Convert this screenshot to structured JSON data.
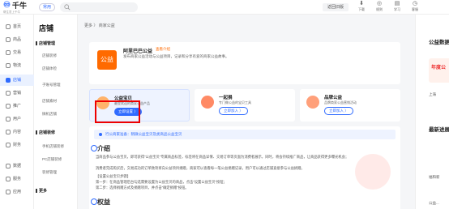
{
  "top": {
    "logo_mark": "♾",
    "logo_name": "千牛",
    "logo_sub": "帮生意上千牛",
    "env": "常用",
    "back_label": "返回旧版",
    "icons": [
      {
        "glyph": "⬇",
        "label": "下载",
        "icon": "download-icon"
      },
      {
        "glyph": "◎",
        "label": "规则",
        "icon": "rules-icon"
      },
      {
        "glyph": "▤",
        "label": "学习",
        "icon": "study-icon"
      },
      {
        "glyph": "◷",
        "label": "客服",
        "icon": "service-icon"
      }
    ]
  },
  "leftnav": [
    {
      "label": "首页"
    },
    {
      "label": "商品"
    },
    {
      "label": "交易"
    },
    {
      "label": "物流"
    },
    {
      "label": "店铺",
      "active": true
    },
    {
      "label": "营销"
    },
    {
      "label": "推广"
    },
    {
      "label": "用户"
    },
    {
      "label": "内容"
    },
    {
      "label": "财务"
    },
    {
      "label": "数据"
    },
    {
      "label": "服务"
    },
    {
      "label": "应用"
    }
  ],
  "subnav": {
    "title": "店铺",
    "groups": [
      {
        "head": "店铺管理",
        "items": [
          "店铺装修",
          "店铺体检",
          "子账号管理",
          "店铺素材",
          "微机店铺"
        ]
      },
      {
        "head": "店铺装修",
        "items": [
          "手机店铺装修",
          "PC店铺装修",
          "装修管理"
        ]
      }
    ],
    "more": "更多"
  },
  "main": {
    "breadcrumb": "更多 〉 商家公益",
    "intro": {
      "logo_text": "公益",
      "title": "阿里巴巴公益",
      "tag": "查看介绍",
      "desc": "发布商家公益活动与公益项目，记录和分享有爱的商家公益故事。"
    },
    "services": [
      {
        "title": "公益宝贝",
        "desc": "最受欢迎的商家公益产品",
        "button": "立即设置 〉"
      },
      {
        "title": "一起捐",
        "desc": "专门做公益的宝贝工具",
        "button": "立即加入 〉"
      },
      {
        "title": "品牌公益",
        "desc": "品牌商家公益营销活动",
        "button": "立即加入 〉"
      }
    ],
    "notice": "行公商家准备：稍微公益宝贝及类商品公益宝贝",
    "section1_title": "介绍",
    "paragraphs": [
      "当商品参与公益宝贝，即可获得“公益宝贝”专属商品标签，标签将在商品详情、交易订单等页面为消费者展示，同时，将会持续推广商品，让商品获得更多曝光机会；",
      "消费者完成购买后，交易成功的订单款项将向公益项目捐赠，商家可以查看每一笔公益捐赠记录，用户可以通过店铺直接参与公益捐赠。",
      "【设置公益宝贝步骤】",
      "第一步：在商品管理后台勾选需要设置为公益宝贝的商品，点击“设置公益宝贝”按钮；",
      "第二步：选择捐赠方式及捐赠项目，并点击“确定捐赠”按钮。"
    ],
    "section2_title": "权益"
  },
  "right": {
    "title1": "公益数据",
    "banner": "年度公",
    "line1": "上海",
    "title2": "最新进展",
    "line2": "福和新",
    "line3": "公益..."
  }
}
